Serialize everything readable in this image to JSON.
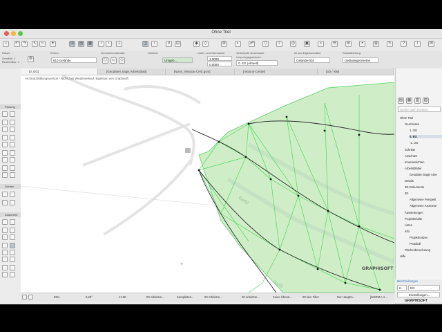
{
  "window": {
    "title": "Ohne Titel"
  },
  "infobar": {
    "haupt_label": "Haupt:",
    "selection_lines": [
      "Gewählt: 1",
      "Bearbeitbar: 1"
    ],
    "ebene_label": "Ebene:",
    "ebene_value": "610 Gelände",
    "geometrie_label": "Geometriemethode:",
    "struktur_label": "Struktur:",
    "struktur_value": "Umgeb...",
    "ober_label": "Unter- und Oberkante:",
    "ober_values": [
      "1,0000",
      "0,0000"
    ],
    "geschosse_label": "Verknüpfte Geschosse:",
    "geschosse_sub": "Ursprungsgeschoss:",
    "geschosse_value": "0. EG (Aktuell)",
    "id_label": "ID und Eigenschaften:",
    "id_value": "Gelände-002",
    "klass_label": "Klassifizierung:",
    "klass_value": "Geländegeometrie"
  },
  "tabs": [
    {
      "label": "[0. EG]"
    },
    {
      "label": "[Geodaten Sagis Arbeitsblatt]"
    },
    {
      "label": "[Norm_Window CHE.gsm]"
    },
    {
      "label": "[Aktions-Center]"
    },
    {
      "label": "[3D / Alle]"
    }
  ],
  "toolbox": {
    "sections": [
      "Planung",
      "Sichten",
      "Dokument"
    ]
  },
  "canvas": {
    "watermark_note": "Archicad Bildungsversion - Nicht zum Wiederverkauf. Eigentum von Graphisoft.",
    "street_labels": [
      "6a40",
      "6a40"
    ],
    "logo": "GRAPHISOFT"
  },
  "navigator": {
    "search_placeholder": "Suche nach Kontext",
    "items": [
      {
        "label": "Ohne Titel",
        "indent": 0
      },
      {
        "label": "Geschosse",
        "indent": 1
      },
      {
        "label": "1. OG",
        "indent": 2
      },
      {
        "label": "0. EG",
        "indent": 2,
        "selected": true
      },
      {
        "label": "-1. UG",
        "indent": 2
      },
      {
        "label": "Schnitte",
        "indent": 1
      },
      {
        "label": "Ansichten",
        "indent": 1
      },
      {
        "label": "Innenansichten",
        "indent": 1
      },
      {
        "label": "Arbeitsblätter",
        "indent": 1
      },
      {
        "label": "Geodaten Sagis Arbe",
        "indent": 2
      },
      {
        "label": "Details",
        "indent": 1
      },
      {
        "label": "3D-Dokumente",
        "indent": 1
      },
      {
        "label": "3D",
        "indent": 1
      },
      {
        "label": "Allgemeine Perspekt",
        "indent": 2
      },
      {
        "label": "Allgemeine Axonome",
        "indent": 2
      },
      {
        "label": "Auswertungen",
        "indent": 1
      },
      {
        "label": "Projektinhalte",
        "indent": 1
      },
      {
        "label": "Listen",
        "indent": 1
      },
      {
        "label": "Info",
        "indent": 1
      },
      {
        "label": "Projektnotizen",
        "indent": 2
      },
      {
        "label": "Protokoll",
        "indent": 2
      },
      {
        "label": "Flächenberechnung",
        "indent": 1
      },
      {
        "label": "Hilfe",
        "indent": 0
      }
    ],
    "beschreibungen_label": "Beschreibungen",
    "field_label": "Einstellungen...",
    "name_prefix": "0.",
    "name_value": "EG"
  },
  "statusbar": {
    "items": [
      "69%",
      "0,00°",
      "1:100",
      "00 Arbeitsm...",
      "Komplettes...",
      "00 Arbeitsm...",
      "00 Arbeitsm...",
      "Keine Überar...",
      "00 kein Filter",
      "Nur Hauptm...",
      "[NORM A 4 ..."
    ]
  },
  "footer_logo": "GRAPHISOFT",
  "colors": {
    "terrain_fill": "#cfeec7",
    "terrain_line": "#4fd65a",
    "accent": "#2f74c9"
  }
}
